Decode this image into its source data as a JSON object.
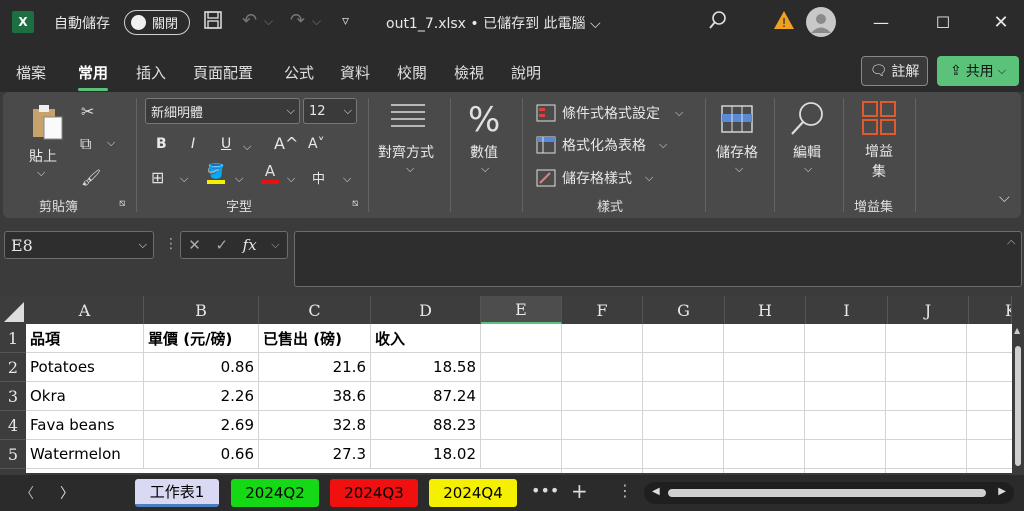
{
  "titlebar": {
    "logo": "X",
    "autosave_label": "自動儲存",
    "autosave_state": "關閉",
    "filename": "out1_7.xlsx • 已儲存到 此電腦 ⌵",
    "icons": [
      "save-icon",
      "undo-icon",
      "redo-icon",
      "customize-icon",
      "search-icon",
      "warning-icon",
      "account-icon",
      "minimize-icon",
      "maximize-icon",
      "close-icon"
    ]
  },
  "menu": {
    "items": [
      "檔案",
      "常用",
      "插入",
      "頁面配置",
      "公式",
      "資料",
      "校閱",
      "檢視",
      "說明"
    ],
    "active": "常用",
    "comment_label": "註解",
    "share_label": "共用"
  },
  "ribbon": {
    "clipboard": {
      "paste": "貼上",
      "group": "剪貼簿"
    },
    "font": {
      "name": "新細明體",
      "size": "12",
      "group": "字型",
      "bold": "B",
      "italic": "I",
      "underline": "U",
      "grow": "A^",
      "shrink": "A˅",
      "phonetic": "中"
    },
    "alignment": {
      "label": "對齊方式"
    },
    "number": {
      "label": "數值"
    },
    "styles": {
      "cond_format": "條件式格式設定",
      "format_table": "格式化為表格",
      "cell_styles": "儲存格樣式",
      "group": "樣式"
    },
    "cells": {
      "label": "儲存格"
    },
    "editing": {
      "label": "編輯"
    },
    "addins": {
      "label": "增益集",
      "group": "增益集"
    }
  },
  "formula_bar": {
    "namebox": "E8",
    "fx": "fx",
    "value": ""
  },
  "grid": {
    "columns": [
      "A",
      "B",
      "C",
      "D",
      "E",
      "F",
      "G",
      "H",
      "I",
      "J",
      "K"
    ],
    "selected_column": "E",
    "rows": [
      {
        "num": "1",
        "cells": [
          "品項",
          "單價 (元/磅)",
          "已售出 (磅)",
          "收入"
        ]
      },
      {
        "num": "2",
        "cells": [
          "Potatoes",
          "0.86",
          "21.6",
          "18.58"
        ]
      },
      {
        "num": "3",
        "cells": [
          "Okra",
          "2.26",
          "38.6",
          "87.24"
        ]
      },
      {
        "num": "4",
        "cells": [
          "Fava beans",
          "2.69",
          "32.8",
          "88.23"
        ]
      },
      {
        "num": "5",
        "cells": [
          "Watermelon",
          "0.66",
          "27.3",
          "18.02"
        ]
      }
    ]
  },
  "sheets": [
    {
      "name": "工作表1",
      "color": "#d9d9f3",
      "active": true
    },
    {
      "name": "2024Q2",
      "color": "#16d916"
    },
    {
      "name": "2024Q3",
      "color": "#f01010"
    },
    {
      "name": "2024Q4",
      "color": "#f5ef00"
    }
  ],
  "colors": {
    "accent": "#5bc27a",
    "chrome": "#2b2b2b",
    "ribbon": "#4a4a4a"
  }
}
